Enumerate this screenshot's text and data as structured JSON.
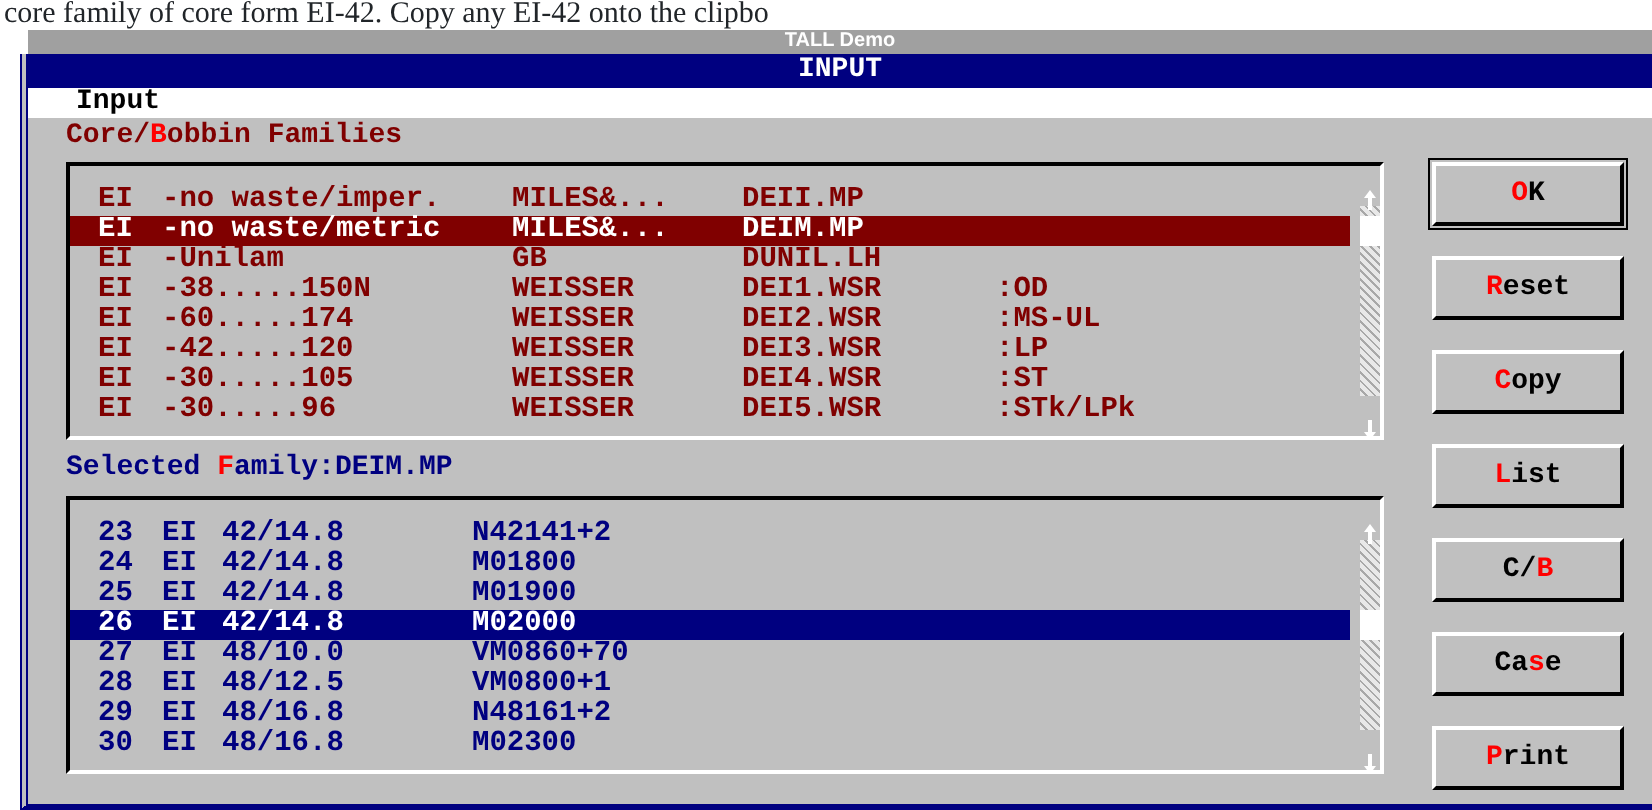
{
  "document_text": "core family of core form EI-42. Copy any EI-42 onto the clipbo",
  "app_window": {
    "title": "TALL Demo"
  },
  "dialog": {
    "title": "INPUT",
    "menu": "Input"
  },
  "families_label": {
    "pre": "Core/",
    "key": "B",
    "post": "obbin Families"
  },
  "families": [
    {
      "cells": [
        "EI",
        "-no waste/imper.",
        "MILES&...",
        "DEII.MP",
        ""
      ],
      "selected": false
    },
    {
      "cells": [
        "EI",
        "-no waste/metric",
        "MILES&...",
        "DEIM.MP",
        ""
      ],
      "selected": true
    },
    {
      "cells": [
        "EI",
        "-Unilam",
        "GB",
        "DUNIL.LH",
        ""
      ],
      "selected": false
    },
    {
      "cells": [
        "EI",
        "-38.....150N",
        "WEISSER",
        "DEI1.WSR",
        ":OD"
      ],
      "selected": false
    },
    {
      "cells": [
        "EI",
        "-60.....174",
        "WEISSER",
        "DEI2.WSR",
        ":MS-UL"
      ],
      "selected": false
    },
    {
      "cells": [
        "EI",
        "-42.....120",
        "WEISSER",
        "DEI3.WSR",
        ":LP"
      ],
      "selected": false
    },
    {
      "cells": [
        "EI",
        "-30.....105",
        "WEISSER",
        "DEI4.WSR",
        ":ST"
      ],
      "selected": false
    },
    {
      "cells": [
        "EI",
        "-30.....96",
        "WEISSER",
        "DEI5.WSR",
        ":STk/LPk"
      ],
      "selected": false
    }
  ],
  "selected_label": {
    "pre": "Selected ",
    "key": "F",
    "post": "amily:DEIM.MP"
  },
  "cores": [
    {
      "cells": [
        "23",
        "EI",
        "42/14.8",
        "N42141+2"
      ],
      "selected": false
    },
    {
      "cells": [
        "24",
        "EI",
        "42/14.8",
        "M01800"
      ],
      "selected": false
    },
    {
      "cells": [
        "25",
        "EI",
        "42/14.8",
        "M01900"
      ],
      "selected": false
    },
    {
      "cells": [
        "26",
        "EI",
        "42/14.8",
        "M02000"
      ],
      "selected": true
    },
    {
      "cells": [
        "27",
        "EI",
        "48/10.0",
        "VM0860+70"
      ],
      "selected": false
    },
    {
      "cells": [
        "28",
        "EI",
        "48/12.5",
        "VM0800+1"
      ],
      "selected": false
    },
    {
      "cells": [
        "29",
        "EI",
        "48/16.8",
        "N48161+2"
      ],
      "selected": false
    },
    {
      "cells": [
        "30",
        "EI",
        "48/16.8",
        "M02300"
      ],
      "selected": false
    }
  ],
  "buttons": [
    {
      "key": "O",
      "post": "K",
      "default": true
    },
    {
      "key": "R",
      "post": "eset",
      "default": false
    },
    {
      "key": "C",
      "post": "opy",
      "default": false
    },
    {
      "key": "L",
      "post": "ist",
      "default": false
    },
    {
      "pre": "C/",
      "key": "B",
      "default": false
    },
    {
      "pre": "Ca",
      "key": "s",
      "post": "e",
      "default": false
    },
    {
      "key": "P",
      "post": "rint",
      "default": false
    }
  ]
}
